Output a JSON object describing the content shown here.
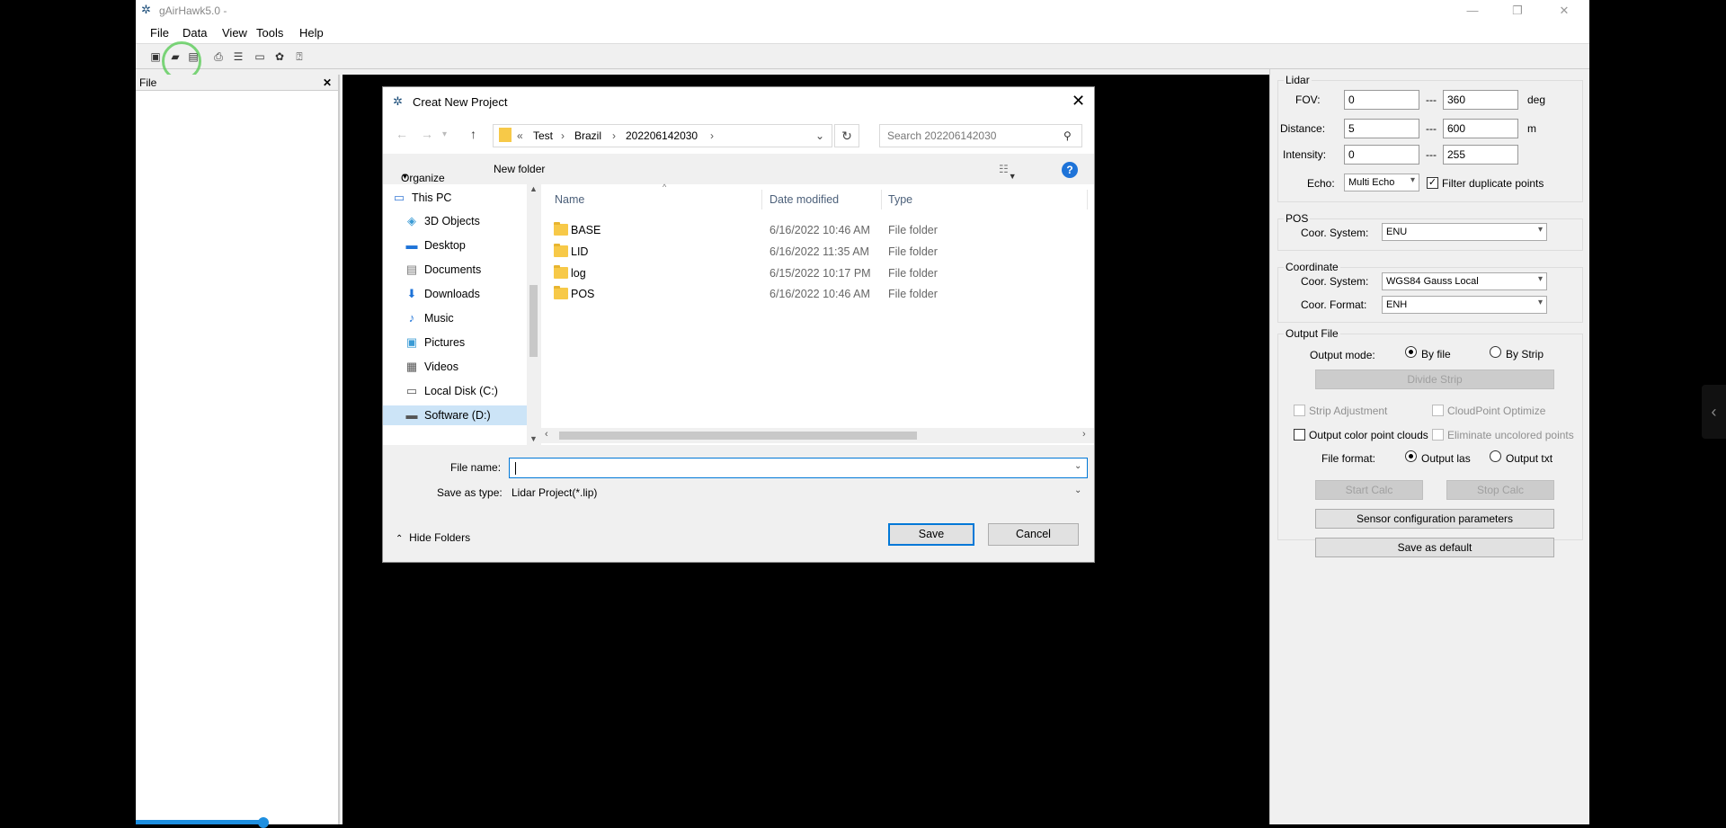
{
  "window": {
    "title": "gAirHawk5.0 -",
    "menu": [
      "File",
      "Data",
      "View",
      "Tools",
      "Help"
    ]
  },
  "left_panel": {
    "header": "File"
  },
  "right_panel": {
    "lidar": {
      "title": "Lidar",
      "fov_label": "FOV:",
      "fov_min": "0",
      "fov_max": "360",
      "fov_unit": "deg",
      "distance_label": "Distance:",
      "distance_min": "5",
      "distance_max": "600",
      "distance_unit": "m",
      "intensity_label": "Intensity:",
      "intensity_min": "0",
      "intensity_max": "255",
      "range_sep": "---",
      "echo_label": "Echo:",
      "echo_value": "Multi Echo",
      "filter_duplicate_label": "Filter duplicate points",
      "filter_duplicate_checked": true
    },
    "pos": {
      "title": "POS",
      "coor_system_label": "Coor. System:",
      "coor_system_value": "ENU"
    },
    "coordinate": {
      "title": "Coordinate",
      "coor_system_label": "Coor. System:",
      "coor_system_value": "WGS84 Gauss Local",
      "coor_format_label": "Coor. Format:",
      "coor_format_value": "ENH"
    },
    "output": {
      "title": "Output File",
      "mode_label": "Output mode:",
      "mode_by_file": "By file",
      "mode_by_strip": "By Strip",
      "divide_strip": "Divide Strip",
      "strip_adjustment": "Strip Adjustment",
      "cloudpoint_optimize": "CloudPoint Optimize",
      "output_color": "Output color point clouds",
      "eliminate_uncolored": "Eliminate uncolored points",
      "format_label": "File format:",
      "format_las": "Output las",
      "format_txt": "Output txt"
    },
    "buttons": {
      "start_calc": "Start Calc",
      "stop_calc": "Stop Calc",
      "sensor_config": "Sensor configuration parameters",
      "save_default": "Save as default"
    }
  },
  "dialog": {
    "title": "Creat New Project",
    "breadcrumb": [
      "«",
      "Test",
      "Brazil",
      "202206142030"
    ],
    "search_placeholder": "Search 202206142030",
    "organize": "Organize",
    "new_folder": "New folder",
    "nav_items": [
      {
        "label": "This PC",
        "icon": "computer-icon"
      },
      {
        "label": "3D Objects",
        "icon": "cube-icon"
      },
      {
        "label": "Desktop",
        "icon": "desktop-icon"
      },
      {
        "label": "Documents",
        "icon": "document-icon"
      },
      {
        "label": "Downloads",
        "icon": "download-icon"
      },
      {
        "label": "Music",
        "icon": "music-icon"
      },
      {
        "label": "Pictures",
        "icon": "picture-icon"
      },
      {
        "label": "Videos",
        "icon": "video-icon"
      },
      {
        "label": "Local Disk (C:)",
        "icon": "disk-icon"
      },
      {
        "label": "Software (D:)",
        "icon": "drive-icon"
      }
    ],
    "columns": [
      "Name",
      "Date modified",
      "Type"
    ],
    "files": [
      {
        "name": "BASE",
        "date": "6/16/2022 10:46 AM",
        "type": "File folder"
      },
      {
        "name": "LID",
        "date": "6/16/2022 11:35 AM",
        "type": "File folder"
      },
      {
        "name": "log",
        "date": "6/15/2022 10:17 PM",
        "type": "File folder"
      },
      {
        "name": "POS",
        "date": "6/16/2022 10:46 AM",
        "type": "File folder"
      }
    ],
    "file_name_label": "File name:",
    "file_name_value": "",
    "save_type_label": "Save as type:",
    "save_type_value": "Lidar Project(*.lip)",
    "hide_folders": "Hide Folders",
    "save": "Save",
    "cancel": "Cancel"
  }
}
